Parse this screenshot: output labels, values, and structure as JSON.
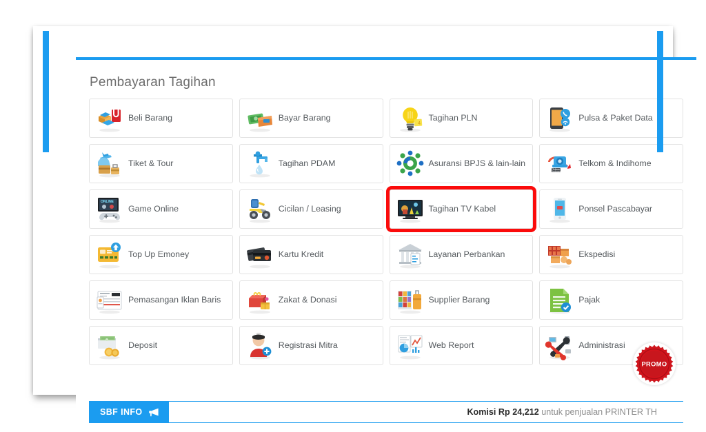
{
  "page": {
    "title": "Pembayaran Tagihan"
  },
  "colors": {
    "accent_blue": "#1b9cf0",
    "selection_red": "#fb0b0b",
    "card_border": "#e2e2e2",
    "title_text": "#6d6d6d",
    "label_text": "#555a5e",
    "promo_red": "#c8161d"
  },
  "menu": {
    "items": [
      {
        "label": "Beli Barang",
        "icon": "shopping-bag-box-icon",
        "selected": false
      },
      {
        "label": "Bayar Barang",
        "icon": "cash-wallet-icon",
        "selected": false
      },
      {
        "label": "Tagihan PLN",
        "icon": "lightbulb-icon",
        "selected": false
      },
      {
        "label": "Pulsa & Paket Data",
        "icon": "smartphone-signal-icon",
        "selected": false
      },
      {
        "label": "Tiket & Tour",
        "icon": "airplane-luggage-icon",
        "selected": false
      },
      {
        "label": "Tagihan PDAM",
        "icon": "water-tap-icon",
        "selected": false
      },
      {
        "label": "Asuransi BPJS & lain-lain",
        "icon": "bpjs-logo-icon",
        "selected": false
      },
      {
        "label": "Telkom & Indihome",
        "icon": "telephone-telkom-icon",
        "selected": false
      },
      {
        "label": "Game Online",
        "icon": "gamepad-online-icon",
        "selected": false
      },
      {
        "label": "Cicilan / Leasing",
        "icon": "motorcycle-icon",
        "selected": false
      },
      {
        "label": "Tagihan TV Kabel",
        "icon": "television-icon",
        "selected": true
      },
      {
        "label": "Ponsel Pascabayar",
        "icon": "mobile-phone-icon",
        "selected": false
      },
      {
        "label": "Top Up Emoney",
        "icon": "emoney-card-icon",
        "selected": false
      },
      {
        "label": "Kartu Kredit",
        "icon": "credit-cards-icon",
        "selected": false
      },
      {
        "label": "Layanan Perbankan",
        "icon": "bank-building-icon",
        "selected": false
      },
      {
        "label": "Ekspedisi",
        "icon": "delivery-boxes-icon",
        "selected": false
      },
      {
        "label": "Pemasangan Iklan Baris",
        "icon": "newspaper-ad-icon",
        "selected": false
      },
      {
        "label": "Zakat & Donasi",
        "icon": "donation-box-icon",
        "selected": false
      },
      {
        "label": "Supplier Barang",
        "icon": "shelf-suitcase-icon",
        "selected": false
      },
      {
        "label": "Pajak",
        "icon": "tax-document-icon",
        "selected": false
      },
      {
        "label": "Deposit",
        "icon": "money-coins-icon",
        "selected": false
      },
      {
        "label": "Registrasi Mitra",
        "icon": "add-user-icon",
        "selected": false
      },
      {
        "label": "Web Report",
        "icon": "report-chart-icon",
        "selected": false
      },
      {
        "label": "Administrasi",
        "icon": "tools-devices-icon",
        "selected": false
      }
    ]
  },
  "infobar": {
    "tag_label": "SBF INFO",
    "tag_icon": "megaphone-icon",
    "ticker_bold": "Komisi Rp 24,212",
    "ticker_rest": " untuk penjualan PRINTER TH"
  },
  "promo": {
    "label": "PROMO"
  }
}
